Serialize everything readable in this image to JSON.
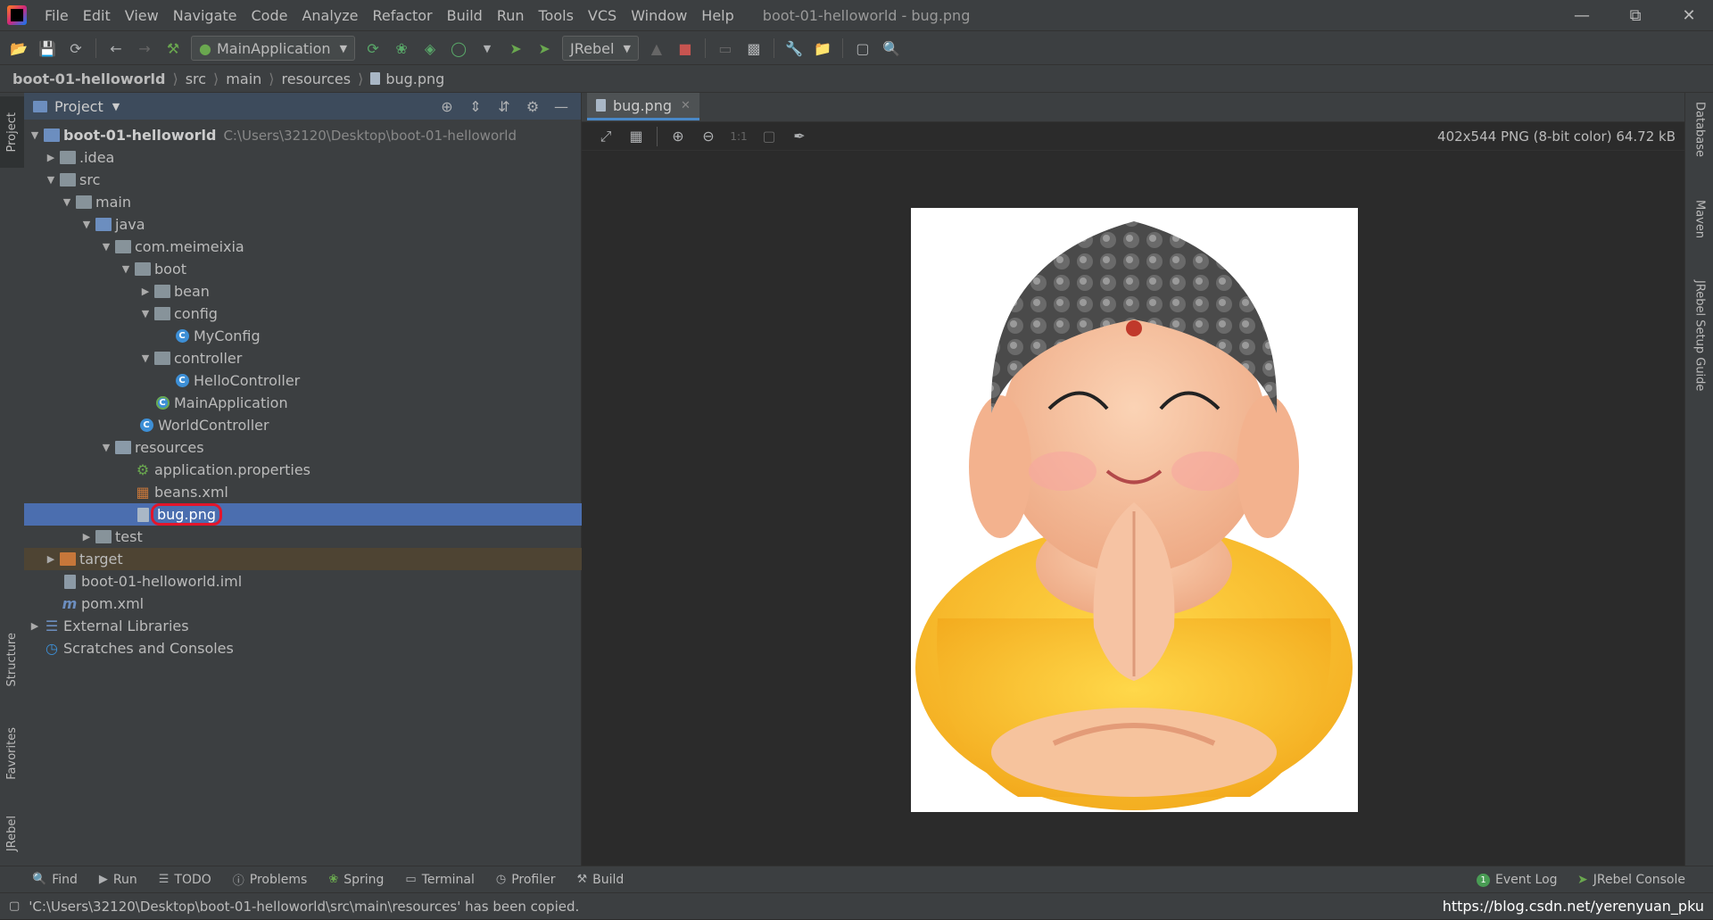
{
  "window": {
    "title": "boot-01-helloworld - bug.png"
  },
  "menu": [
    "File",
    "Edit",
    "View",
    "Navigate",
    "Code",
    "Analyze",
    "Refactor",
    "Build",
    "Run",
    "Tools",
    "VCS",
    "Window",
    "Help"
  ],
  "toolbar": {
    "run_config": "MainApplication",
    "jrebel_combo": "JRebel"
  },
  "breadcrumb": [
    "boot-01-helloworld",
    "src",
    "main",
    "resources",
    "bug.png"
  ],
  "left_tabs": {
    "project": "Project",
    "structure": "Structure",
    "favorites": "Favorites",
    "jrebel": "JRebel"
  },
  "project_panel": {
    "title": "Project",
    "tree": [
      {
        "label": "boot-01-helloworld",
        "hint": "C:\\Users\\32120\\Desktop\\boot-01-helloworld"
      },
      {
        "label": ".idea"
      },
      {
        "label": "src"
      },
      {
        "label": "main"
      },
      {
        "label": "java"
      },
      {
        "label": "com.meimeixia"
      },
      {
        "label": "boot"
      },
      {
        "label": "bean"
      },
      {
        "label": "config"
      },
      {
        "label": "MyConfig"
      },
      {
        "label": "controller"
      },
      {
        "label": "HelloController"
      },
      {
        "label": "MainApplication"
      },
      {
        "label": "WorldController"
      },
      {
        "label": "resources"
      },
      {
        "label": "application.properties"
      },
      {
        "label": "beans.xml"
      },
      {
        "label": "bug.png"
      },
      {
        "label": "test"
      },
      {
        "label": "target"
      },
      {
        "label": "boot-01-helloworld.iml"
      },
      {
        "label": "pom.xml"
      },
      {
        "label": "External Libraries"
      },
      {
        "label": "Scratches and Consoles"
      }
    ]
  },
  "editor": {
    "tab": "bug.png",
    "zoom_label": "1:1",
    "image_info": "402x544 PNG (8-bit color) 64.72 kB"
  },
  "right_tabs": {
    "database": "Database",
    "maven": "Maven",
    "jrebel_guide": "JRebel Setup Guide"
  },
  "bottom_tools": [
    "Find",
    "Run",
    "TODO",
    "Problems",
    "Spring",
    "Terminal",
    "Profiler",
    "Build"
  ],
  "bottom_right": {
    "event_log": "Event Log",
    "event_log_count": "1",
    "jrebel_console": "JRebel Console"
  },
  "status": {
    "message": "'C:\\Users\\32120\\Desktop\\boot-01-helloworld\\src\\main\\resources' has been copied.",
    "watermark": "https://blog.csdn.net/yerenyuan_pku"
  }
}
